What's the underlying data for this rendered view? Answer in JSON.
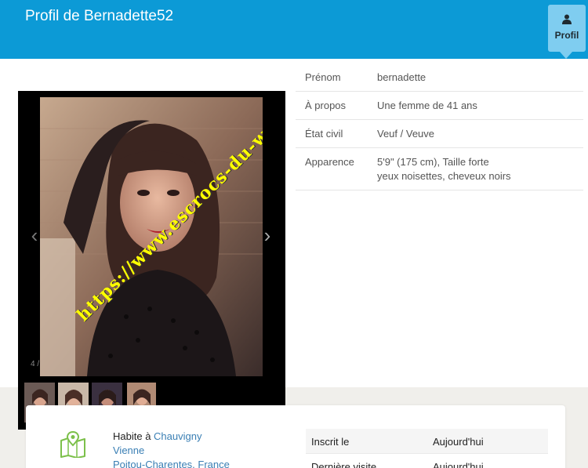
{
  "header": {
    "title": "Profil de Bernadette52",
    "profile_button_label": "Profil",
    "accent": "#0c9ad6"
  },
  "gallery": {
    "counter": "4 /",
    "watermark": "https://www.escrocs-du-web.fr",
    "prev_icon": "chevron-left-icon",
    "next_icon": "chevron-right-icon"
  },
  "info": {
    "rows": [
      {
        "label": "Prénom",
        "value": "bernadette"
      },
      {
        "label": "À propos",
        "value": "Une femme de 41 ans"
      },
      {
        "label": "État civil",
        "value": "Veuf / Veuve"
      },
      {
        "label": "Apparence",
        "value_line1": "5'9\" (175 cm), Taille forte",
        "value_line2": "yeux noisettes, cheveux noirs"
      }
    ]
  },
  "location": {
    "prefix": "Habite à ",
    "city": "Chauvigny",
    "department": "Vienne",
    "region": "Poitou-Charentes, France",
    "icon": "map-icon"
  },
  "meta": {
    "rows": [
      {
        "label": "Inscrit le",
        "value": "Aujourd'hui"
      },
      {
        "label": "Dernière visite",
        "value": "Aujourd'hui"
      }
    ]
  }
}
